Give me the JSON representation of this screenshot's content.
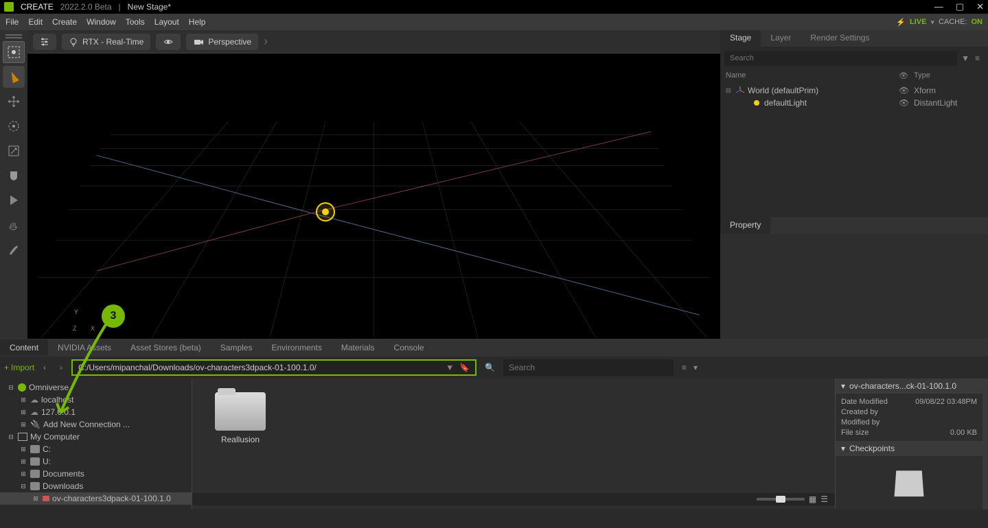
{
  "title": {
    "app": "CREATE",
    "version": "2022.2.0 Beta",
    "stage": "New Stage*"
  },
  "menu": [
    "File",
    "Edit",
    "Create",
    "Window",
    "Tools",
    "Layout",
    "Help"
  ],
  "status": {
    "live": "LIVE",
    "cache_label": "CACHE:",
    "cache_value": "ON"
  },
  "viewport_toolbar": {
    "renderer": "RTX - Real-Time",
    "camera": "Perspective"
  },
  "callout": "3",
  "right_panel": {
    "tabs": [
      "Stage",
      "Layer",
      "Render Settings"
    ],
    "search_placeholder": "Search",
    "headers": {
      "name": "Name",
      "type": "Type"
    },
    "tree": [
      {
        "name": "World (defaultPrim)",
        "type": "Xform",
        "indent": 0,
        "expanded": true,
        "icon": "axes"
      },
      {
        "name": "defaultLight",
        "type": "DistantLight",
        "indent": 1,
        "icon": "light"
      }
    ],
    "property_tab": "Property"
  },
  "content_tabs": [
    "Content",
    "NVIDIA Assets",
    "Asset Stores (beta)",
    "Samples",
    "Environments",
    "Materials",
    "Console"
  ],
  "content_toolbar": {
    "import": "Import",
    "path": "C:/Users/mipanchal/Downloads/ov-characters3dpack-01-100.1.0/",
    "search_placeholder": "Search"
  },
  "content_tree": [
    {
      "label": "Omniverse",
      "indent": 0,
      "exp": "minus",
      "icon": "ov"
    },
    {
      "label": "localhost",
      "indent": 1,
      "exp": "plus",
      "icon": "cloud"
    },
    {
      "label": "127.0.0.1",
      "indent": 1,
      "exp": "plus",
      "icon": "cloud"
    },
    {
      "label": "Add New Connection ...",
      "indent": 1,
      "exp": "plus",
      "icon": "plus"
    },
    {
      "label": "My Computer",
      "indent": 0,
      "exp": "minus",
      "icon": "monitor"
    },
    {
      "label": "C:",
      "indent": 1,
      "exp": "plus",
      "icon": "drive"
    },
    {
      "label": "U:",
      "indent": 1,
      "exp": "plus",
      "icon": "drive"
    },
    {
      "label": "Documents",
      "indent": 1,
      "exp": "plus",
      "icon": "drive"
    },
    {
      "label": "Downloads",
      "indent": 1,
      "exp": "minus",
      "icon": "drive"
    },
    {
      "label": "ov-characters3dpack-01-100.1.0",
      "indent": 2,
      "exp": "plus",
      "icon": "folder",
      "selected": true
    }
  ],
  "content_grid": {
    "items": [
      {
        "name": "Reallusion"
      }
    ]
  },
  "content_details": {
    "title": "ov-characters...ck-01-100.1.0",
    "rows": [
      {
        "label": "Date Modified",
        "value": "09/08/22 03:48PM"
      },
      {
        "label": "Created by",
        "value": ""
      },
      {
        "label": "Modified by",
        "value": ""
      },
      {
        "label": "File size",
        "value": "0.00 KB"
      }
    ],
    "checkpoints": "Checkpoints"
  }
}
